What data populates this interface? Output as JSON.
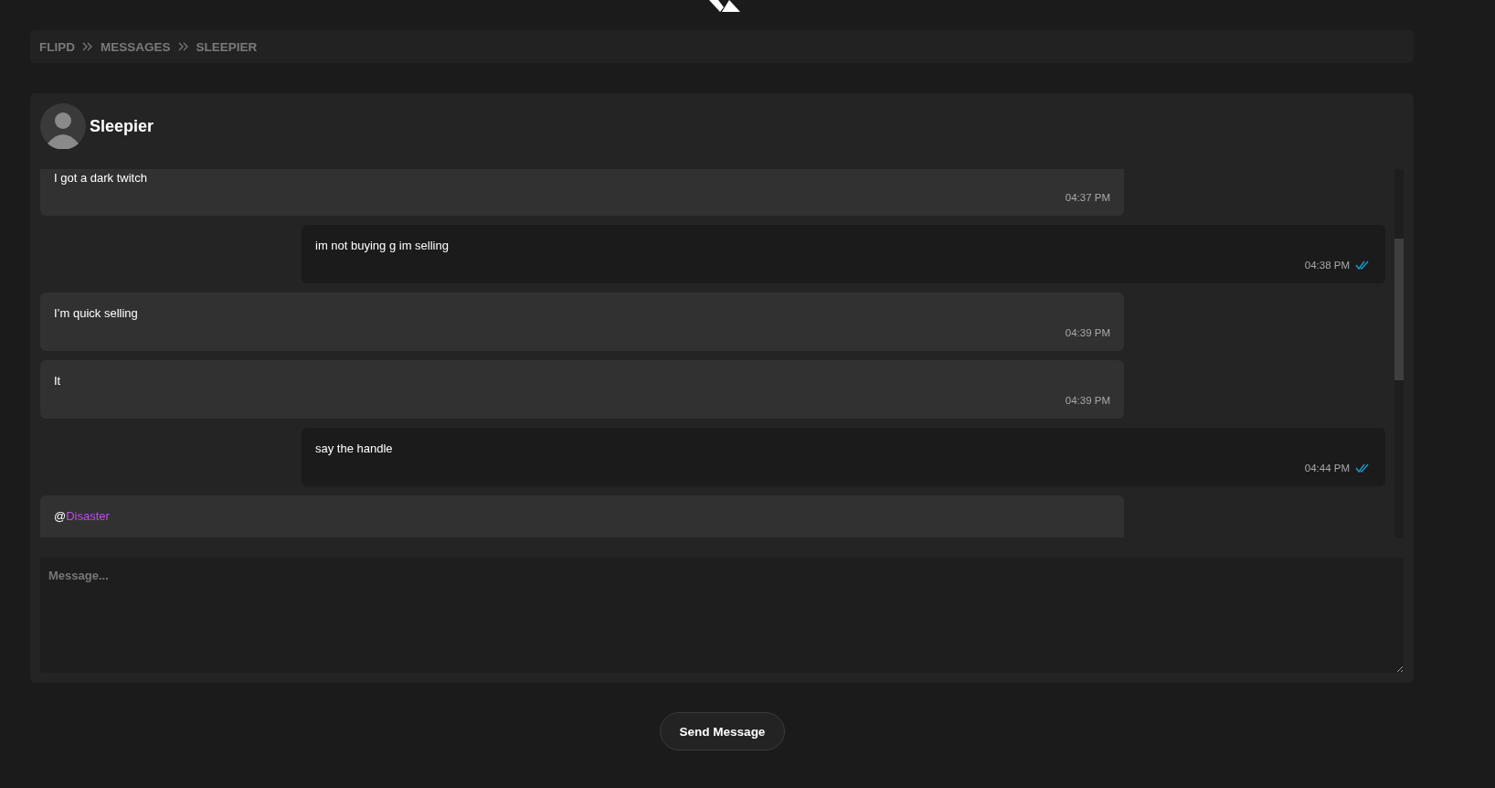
{
  "breadcrumb": [
    {
      "label": "FLIPD"
    },
    {
      "label": "MESSAGES"
    },
    {
      "label": "SLEEPIER"
    }
  ],
  "chat": {
    "contact": {
      "name": "Sleepier"
    },
    "messages": [
      {
        "kind": "incoming",
        "text": "I got a dark twitch",
        "time": "04:37 PM"
      },
      {
        "kind": "outgoing",
        "text": "im not buying g im selling",
        "time": "04:38 PM",
        "read": true
      },
      {
        "kind": "incoming",
        "text": "I’m quick selling",
        "time": "04:39 PM"
      },
      {
        "kind": "incoming",
        "text": "It",
        "time": "04:39 PM"
      },
      {
        "kind": "outgoing",
        "text": "say the handle",
        "time": "04:44 PM",
        "read": true
      },
      {
        "kind": "incoming",
        "text": "@",
        "mention": "Disaster"
      }
    ],
    "composer": {
      "placeholder": "Message..."
    }
  },
  "send_button": "Send Message"
}
